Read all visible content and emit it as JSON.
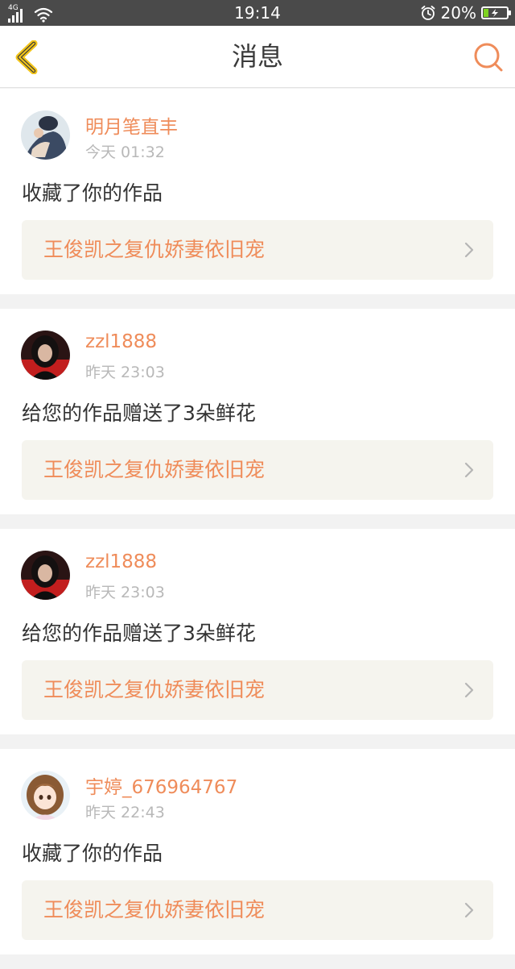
{
  "status_bar": {
    "network": "4G",
    "time": "19:14",
    "battery_percent": "20%",
    "battery_level": 0.2,
    "icons": [
      "signal-icon",
      "wifi-icon",
      "alarm-icon",
      "battery-charging-icon"
    ]
  },
  "header": {
    "title": "消息",
    "back_icon": "chevron-left-icon",
    "search_icon": "search-icon"
  },
  "colors": {
    "accent": "#ef8c5a",
    "back_icon": "#f2c419",
    "link_bg": "#f5f4ee",
    "status_bar_bg": "#4a4a4a"
  },
  "messages": [
    {
      "user": "明月笔直丰",
      "time": "今天 01:32",
      "action": "收藏了你的作品",
      "work": "王俊凯之复仇娇妻依旧宠"
    },
    {
      "user": "zzl1888",
      "time": "昨天 23:03",
      "action": "给您的作品赠送了3朵鲜花",
      "work": "王俊凯之复仇娇妻依旧宠"
    },
    {
      "user": "zzl1888",
      "time": "昨天 23:03",
      "action": "给您的作品赠送了3朵鲜花",
      "work": "王俊凯之复仇娇妻依旧宠"
    },
    {
      "user": "宇婷_676964767",
      "time": "昨天 22:43",
      "action": "收藏了你的作品",
      "work": "王俊凯之复仇娇妻依旧宠"
    }
  ]
}
